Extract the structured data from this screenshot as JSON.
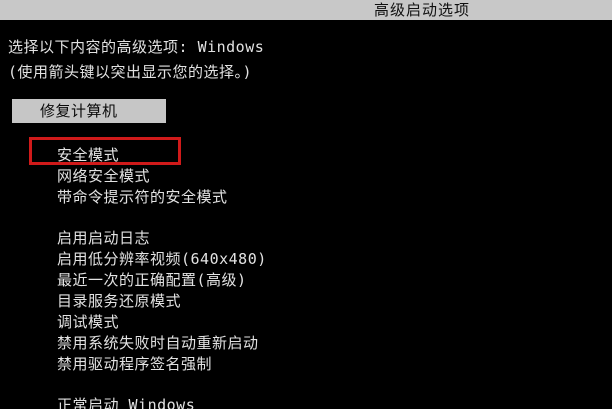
{
  "title": "高级启动选项",
  "prompt": {
    "line1": "选择以下内容的高级选项: Windows",
    "line2": "(使用箭头键以突出显示您的选择。)"
  },
  "selected": "修复计算机",
  "options": [
    "安全模式",
    "网络安全模式",
    "带命令提示符的安全模式",
    "启用启动日志",
    "启用低分辨率视频(640x480)",
    "最近一次的正确配置(高级)",
    "目录服务还原模式",
    "调试模式",
    "禁用系统失败时自动重新启动",
    "禁用驱动程序签名强制",
    "正常启动 Windows"
  ],
  "colors": {
    "background": "#000000",
    "text": "#e2e2e2",
    "highlight": "#c6c6c6",
    "annotation": "#d01a1a"
  }
}
